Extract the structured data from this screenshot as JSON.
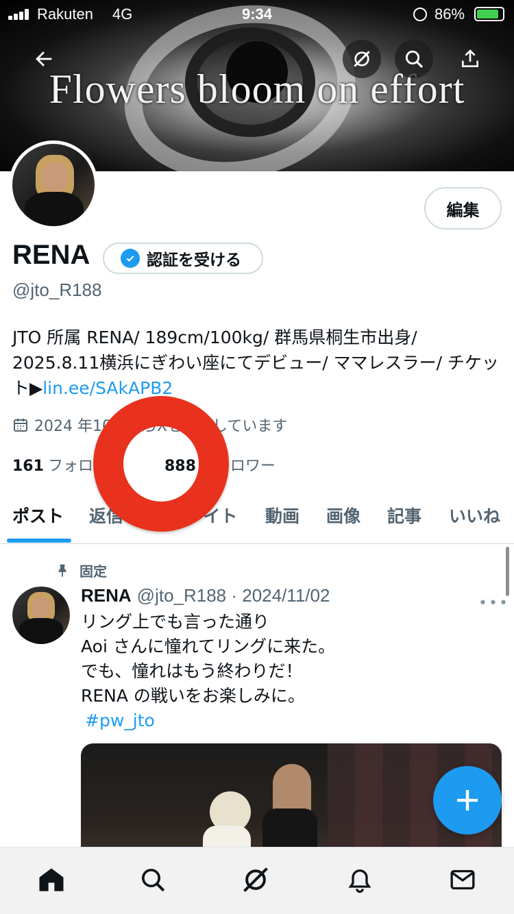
{
  "status_bar": {
    "carrier": "Rakuten",
    "network": "4G",
    "time": "9:34",
    "battery": "86%",
    "battery_level": 0.86
  },
  "header": {
    "banner_text": "Flowers bloom on effort"
  },
  "profile": {
    "edit_label": "編集",
    "name": "RENA",
    "verify_label": "認証を受ける",
    "handle": "@jto_R188",
    "bio_text": "JTO 所属 RENA/ 189cm/100kg/ 群馬県桐生市出身/ 2025.8.11横浜にぎわい座にてデビュー/ ママレスラー/ チケット▶",
    "bio_link": "lin.ee/SAkAPB2",
    "joined": "2024 年10月からXを利用しています",
    "following_count": "161",
    "following_label": "フォロー中",
    "followers_count": "888",
    "followers_label": "フォロワー"
  },
  "tabs": [
    "ポスト",
    "返信",
    "ハイライト",
    "動画",
    "画像",
    "記事",
    "いいね"
  ],
  "post": {
    "pinned_label": "固定",
    "author": "RENA",
    "handle_date": "@jto_R188 · 2024/11/02",
    "lines": [
      "リング上でも言った通り",
      "Aoi さんに憧れてリングに来た。",
      "でも、憧れはもう終わりだ！",
      "RENA の戦いをお楽しみに。"
    ],
    "hashtag": "#pw_jto",
    "more": "•••"
  },
  "colors": {
    "accent": "#1d9bf0",
    "ring": "#e8321d",
    "text": "#0f1419",
    "secondary": "#536471"
  },
  "icons": {
    "back": "arrow-left-icon",
    "grok": "grok-icon",
    "search": "search-icon",
    "share": "share-icon",
    "calendar": "calendar-icon",
    "pin": "pin-icon",
    "compose": "plus-icon",
    "home": "home-icon",
    "explore": "search-icon",
    "grok_nav": "grok-icon",
    "notifications": "bell-icon",
    "messages": "mail-icon"
  }
}
